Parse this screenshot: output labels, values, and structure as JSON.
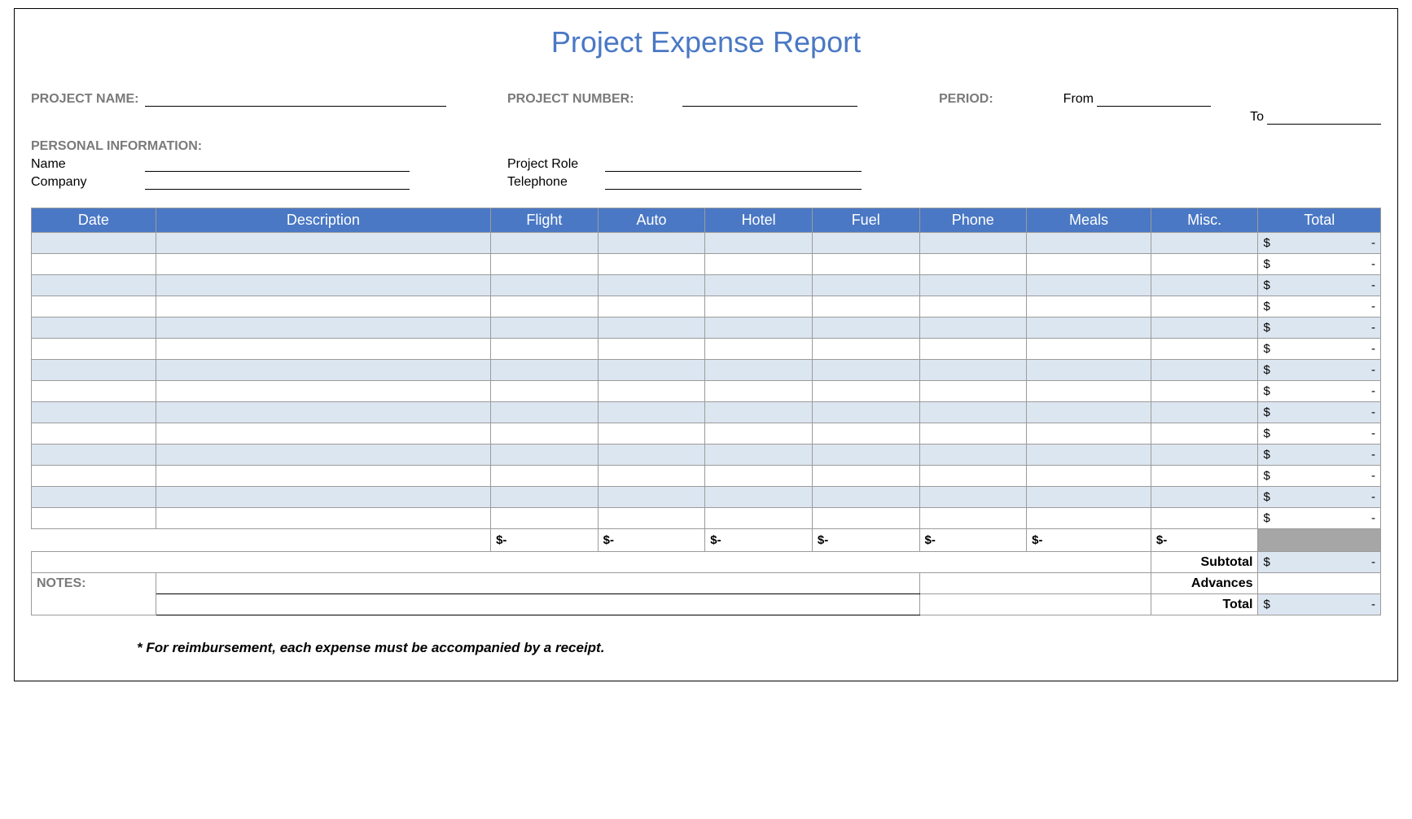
{
  "title": "Project Expense Report",
  "labels": {
    "project_name": "PROJECT NAME:",
    "project_number": "PROJECT NUMBER:",
    "period": "PERIOD:",
    "from": "From",
    "to": "To",
    "personal_info": "PERSONAL INFORMATION:",
    "name": "Name",
    "company": "Company",
    "project_role": "Project Role",
    "telephone": "Telephone",
    "notes": "NOTES:",
    "subtotal": "Subtotal",
    "advances": "Advances",
    "total": "Total"
  },
  "columns": [
    "Date",
    "Description",
    "Flight",
    "Auto",
    "Hotel",
    "Fuel",
    "Phone",
    "Meals",
    "Misc.",
    "Total"
  ],
  "rows": [
    {
      "total": "$          -"
    },
    {
      "total": "$          -"
    },
    {
      "total": "$          -"
    },
    {
      "total": "$          -"
    },
    {
      "total": "$          -"
    },
    {
      "total": "$          -"
    },
    {
      "total": "$          -"
    },
    {
      "total": "$          -"
    },
    {
      "total": "$          -"
    },
    {
      "total": "$          -"
    },
    {
      "total": "$          -"
    },
    {
      "total": "$          -"
    },
    {
      "total": "$          -"
    },
    {
      "total": "$          -"
    }
  ],
  "col_totals": [
    "$        -",
    "$        -",
    "$        -",
    "$        -",
    "$        -",
    "$        -",
    "$        -"
  ],
  "summary": {
    "subtotal": "$          -",
    "advances": "",
    "total": "$          -"
  },
  "footnote": "* For reimbursement, each expense must be accompanied by a receipt."
}
